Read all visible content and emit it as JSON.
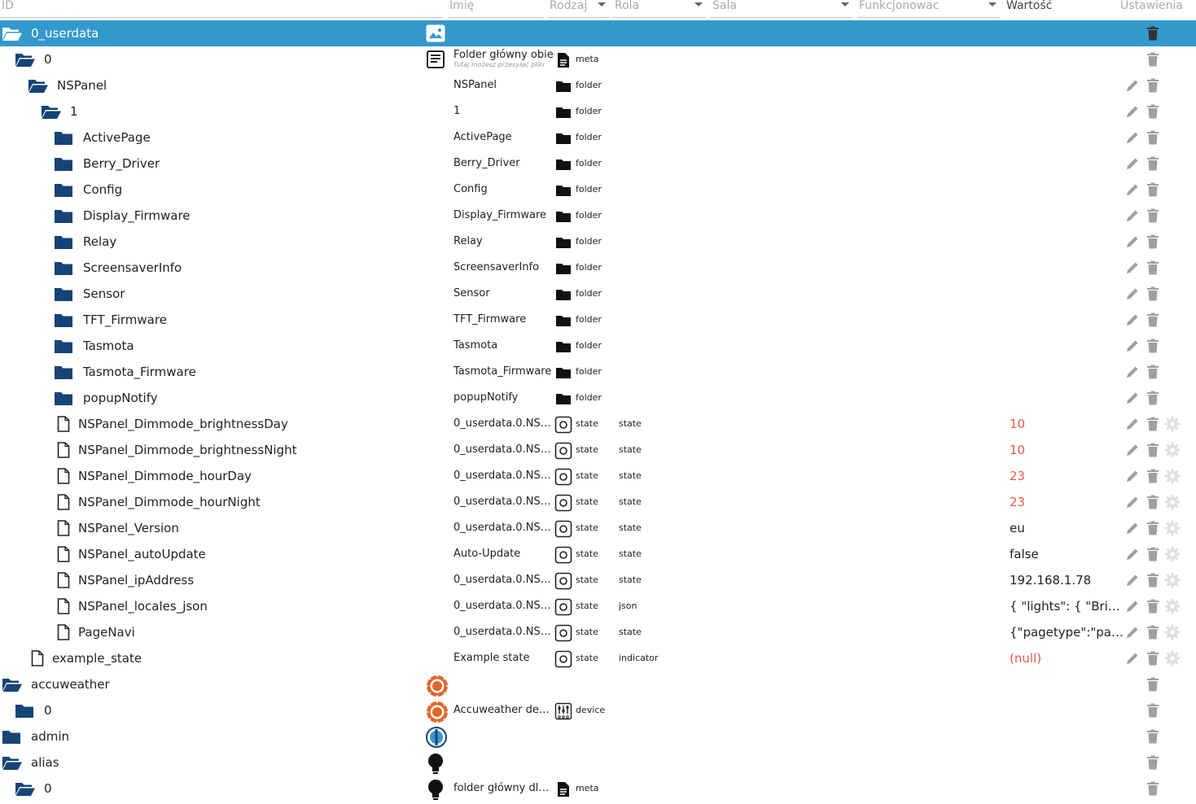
{
  "header": {
    "id_placeholder": "ID",
    "name_placeholder": "Imię",
    "type_select": "Rodzaj",
    "role_select": "Rola",
    "room_select": "Sala",
    "function_select": "Funkcjonowac",
    "value_label": "Wartość",
    "settings_label": "Ustawienia"
  },
  "colors": {
    "selected": "#3399cc",
    "folder": "#164477",
    "red_value": "#e25a4a",
    "action_icon": "#a0a0a0"
  },
  "rows": [
    {
      "id": "0_userdata",
      "level": 0,
      "icon": "folder-open",
      "selected": true,
      "obj_icon": "image",
      "actions": "t"
    },
    {
      "id": "0",
      "level": 1,
      "icon": "folder-open",
      "obj_icon": "doc",
      "name": "Folder główny obiekt",
      "subtitle": "Tutaj możesz przesyłać pliki",
      "type_icon": "file",
      "type": "meta",
      "actions": "t"
    },
    {
      "id": "NSPanel",
      "level": 2,
      "icon": "folder-open",
      "name": "NSPanel",
      "type_icon": "folder",
      "type": "folder",
      "actions": "pt"
    },
    {
      "id": "1",
      "level": 3,
      "icon": "folder-open",
      "name": "1",
      "type_icon": "folder",
      "type": "folder",
      "actions": "pt"
    },
    {
      "id": "ActivePage",
      "level": 4,
      "icon": "folder",
      "name": "ActivePage",
      "type_icon": "folder",
      "type": "folder",
      "actions": "pt"
    },
    {
      "id": "Berry_Driver",
      "level": 4,
      "icon": "folder",
      "name": "Berry_Driver",
      "type_icon": "folder",
      "type": "folder",
      "actions": "pt"
    },
    {
      "id": "Config",
      "level": 4,
      "icon": "folder",
      "name": "Config",
      "type_icon": "folder",
      "type": "folder",
      "actions": "pt"
    },
    {
      "id": "Display_Firmware",
      "level": 4,
      "icon": "folder",
      "name": "Display_Firmware",
      "type_icon": "folder",
      "type": "folder",
      "actions": "pt"
    },
    {
      "id": "Relay",
      "level": 4,
      "icon": "folder",
      "name": "Relay",
      "type_icon": "folder",
      "type": "folder",
      "actions": "pt"
    },
    {
      "id": "ScreensaverInfo",
      "level": 4,
      "icon": "folder",
      "name": "ScreensaverInfo",
      "type_icon": "folder",
      "type": "folder",
      "actions": "pt"
    },
    {
      "id": "Sensor",
      "level": 4,
      "icon": "folder",
      "name": "Sensor",
      "type_icon": "folder",
      "type": "folder",
      "actions": "pt"
    },
    {
      "id": "TFT_Firmware",
      "level": 4,
      "icon": "folder",
      "name": "TFT_Firmware",
      "type_icon": "folder",
      "type": "folder",
      "actions": "pt"
    },
    {
      "id": "Tasmota",
      "level": 4,
      "icon": "folder",
      "name": "Tasmota",
      "type_icon": "folder",
      "type": "folder",
      "actions": "pt"
    },
    {
      "id": "Tasmota_Firmware",
      "level": 4,
      "icon": "folder",
      "name": "Tasmota_Firmware",
      "type_icon": "folder",
      "type": "folder",
      "actions": "pt"
    },
    {
      "id": "popupNotify",
      "level": 4,
      "icon": "folder",
      "name": "popupNotify",
      "type_icon": "folder",
      "type": "folder",
      "actions": "pt"
    },
    {
      "id": "NSPanel_Dimmode_brightnessDay",
      "level": 4,
      "icon": "file",
      "name": "0_userdata.0.NSPa...",
      "type_icon": "state",
      "type": "state",
      "role": "state",
      "value": "10",
      "value_red": true,
      "actions": "ptg"
    },
    {
      "id": "NSPanel_Dimmode_brightnessNight",
      "level": 4,
      "icon": "file",
      "name": "0_userdata.0.NSPa...",
      "type_icon": "state",
      "type": "state",
      "role": "state",
      "value": "10",
      "value_red": true,
      "actions": "ptg"
    },
    {
      "id": "NSPanel_Dimmode_hourDay",
      "level": 4,
      "icon": "file",
      "name": "0_userdata.0.NSPa...",
      "type_icon": "state",
      "type": "state",
      "role": "state",
      "value": "23",
      "value_red": true,
      "actions": "ptg"
    },
    {
      "id": "NSPanel_Dimmode_hourNight",
      "level": 4,
      "icon": "file",
      "name": "0_userdata.0.NSPa...",
      "type_icon": "state",
      "type": "state",
      "role": "state",
      "value": "23",
      "value_red": true,
      "actions": "ptg"
    },
    {
      "id": "NSPanel_Version",
      "level": 4,
      "icon": "file",
      "name": "0_userdata.0.NSPa...",
      "type_icon": "state",
      "type": "state",
      "role": "state",
      "value": "eu",
      "actions": "ptg"
    },
    {
      "id": "NSPanel_autoUpdate",
      "level": 4,
      "icon": "file",
      "name": "Auto-Update",
      "type_icon": "state",
      "type": "state",
      "role": "state",
      "value": "false",
      "actions": "ptg"
    },
    {
      "id": "NSPanel_ipAddress",
      "level": 4,
      "icon": "file",
      "name": "0_userdata.0.NSPa...",
      "type_icon": "state",
      "type": "state",
      "role": "state",
      "value": "192.168.1.78",
      "actions": "ptg"
    },
    {
      "id": "NSPanel_locales_json",
      "level": 4,
      "icon": "file",
      "name": "0_userdata.0.NSPa...",
      "type_icon": "state",
      "type": "state",
      "role": "json",
      "value": "{ \"lights\": { \"Bright...",
      "actions": "ptg"
    },
    {
      "id": "PageNavi",
      "level": 4,
      "icon": "file",
      "name": "0_userdata.0.NSPa...",
      "type_icon": "state",
      "type": "state",
      "role": "state",
      "value": "{\"pagetype\":\"pag...",
      "actions": "ptg"
    },
    {
      "id": "example_state",
      "level": 2,
      "icon": "file",
      "name": "Example state",
      "type_icon": "state",
      "type": "state",
      "role": "indicator",
      "value": "(null)",
      "value_red": true,
      "actions": "ptg"
    },
    {
      "id": "accuweather",
      "level": 0,
      "icon": "folder-open",
      "obj_icon": "accu",
      "actions": "t"
    },
    {
      "id": "0",
      "level": 1,
      "icon": "folder",
      "obj_icon": "accu",
      "name": "Accuweather device",
      "type_icon": "device",
      "type": "device",
      "actions": "t"
    },
    {
      "id": "admin",
      "level": 0,
      "icon": "folder",
      "obj_icon": "admin",
      "actions": "t"
    },
    {
      "id": "alias",
      "level": 0,
      "icon": "folder-open",
      "obj_icon": "bulb",
      "actions": "t"
    },
    {
      "id": "0",
      "level": 1,
      "icon": "folder-open",
      "obj_icon": "bulb",
      "name": "folder główny dla ...",
      "type_icon": "file",
      "type": "meta",
      "actions": "t"
    }
  ]
}
